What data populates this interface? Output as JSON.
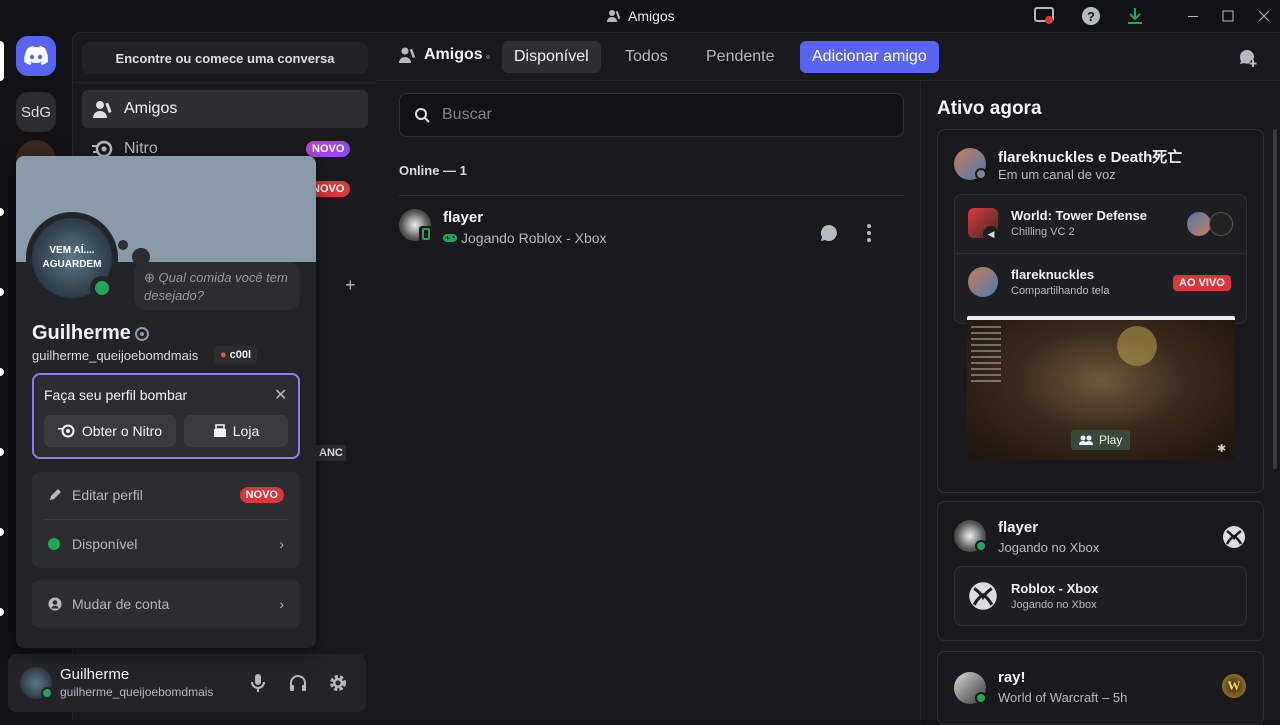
{
  "window": {
    "title": "Amigos"
  },
  "servers": [
    {
      "label": "SdG"
    }
  ],
  "sidebar": {
    "search_label": "Encontre ou comece uma conversa",
    "items": [
      {
        "label": "Amigos"
      },
      {
        "label": "Nitro",
        "badge": "NOVO"
      },
      {
        "badge": "NOVO"
      }
    ],
    "partial_label": "ANC"
  },
  "popout": {
    "avatar_text_1": "VEM AÍ....",
    "avatar_text_2": "AGUARDEM",
    "status_placeholder": "Qual comida você tem desejado?",
    "display_name": "Guilherme",
    "username": "guilherme_queijoebomdmais",
    "tag": "c00l",
    "promo": {
      "title": "Faça seu perfil bombar",
      "nitro_label": "Obter o Nitro",
      "shop_label": "Loja"
    },
    "edit_profile": "Editar perfil",
    "edit_badge": "NOVO",
    "status": "Disponível",
    "switch_account": "Mudar de conta"
  },
  "user_panel": {
    "name": "Guilherme",
    "username": "guilherme_queijoebomdmais"
  },
  "topbar": {
    "title": "Amigos",
    "tabs": [
      "Disponível",
      "Todos",
      "Pendente"
    ],
    "add_friend": "Adicionar amigo"
  },
  "friends": {
    "search_placeholder": "Buscar",
    "online_header": "Online — 1",
    "list": [
      {
        "name": "flayer",
        "activity": "Jogando Roblox - Xbox"
      }
    ]
  },
  "active_now": {
    "title": "Ativo agora",
    "cards": [
      {
        "title": "flareknuckles e Death死亡",
        "subtitle": "Em um canal de voz",
        "voice": {
          "name": "World: Tower Defense",
          "sub": "Chilling VC 2"
        },
        "stream": {
          "name": "flareknuckles",
          "sub": "Compartilhando tela",
          "badge": "AO VIVO",
          "play_label": "Play"
        }
      },
      {
        "title": "flayer",
        "subtitle": "Jogando no Xbox",
        "inner": {
          "name": "Roblox - Xbox",
          "sub": "Jogando no Xbox"
        }
      },
      {
        "title": "ray!",
        "subtitle": "World of Warcraft – 5h"
      }
    ]
  },
  "colors": {
    "brand": "#5865f2",
    "online": "#23a55a",
    "live": "#da373c",
    "nitro_badge": "#b845dd"
  }
}
